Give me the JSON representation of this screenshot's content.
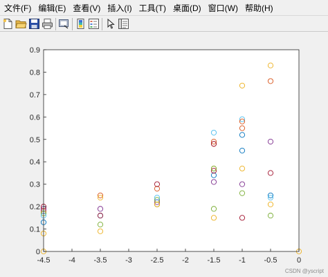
{
  "menu": {
    "items": [
      "文件(F)",
      "编辑(E)",
      "查看(V)",
      "插入(I)",
      "工具(T)",
      "桌面(D)",
      "窗口(W)",
      "帮助(H)"
    ]
  },
  "toolbar": {
    "buttons": [
      "new-file-icon",
      "open-folder-icon",
      "save-icon",
      "print-icon",
      "link-figure-icon",
      "colorbar-icon",
      "legend-icon",
      "pointer-icon",
      "property-inspector-icon"
    ]
  },
  "watermark": "CSDN @yscript",
  "chart_data": {
    "type": "scatter",
    "title": "",
    "xlabel": "",
    "ylabel": "",
    "xlim": [
      -4.5,
      0
    ],
    "ylim": [
      0,
      0.9
    ],
    "xticks": [
      "-4.5",
      "-4",
      "-3.5",
      "-3",
      "-2.5",
      "-2",
      "-1.5",
      "-1",
      "-0.5",
      "0"
    ],
    "yticks": [
      "0",
      "0.1",
      "0.2",
      "0.3",
      "0.4",
      "0.5",
      "0.6",
      "0.7",
      "0.8",
      "0.9"
    ],
    "xtick_values": [
      -4.5,
      -4,
      -3.5,
      -3,
      -2.5,
      -2,
      -1.5,
      -1,
      -0.5,
      0
    ],
    "ytick_values": [
      0,
      0.1,
      0.2,
      0.3,
      0.4,
      0.5,
      0.6,
      0.7,
      0.8,
      0.9
    ],
    "grid": false,
    "marker": "open circle",
    "series": [
      {
        "color": "#0072BD",
        "points": [
          [
            -4.5,
            0.13
          ],
          [
            -3.5,
            0.16
          ],
          [
            -2.5,
            0.21
          ],
          [
            -1.5,
            0.34
          ],
          [
            -1,
            0.45
          ],
          [
            -0.5,
            0.25
          ]
        ]
      },
      {
        "color": "#D95319",
        "points": [
          [
            -4.5,
            0.18
          ],
          [
            -3.5,
            0.25
          ],
          [
            -2.5,
            0.28
          ],
          [
            -1.5,
            0.48
          ],
          [
            -1,
            0.55
          ],
          [
            -0.5,
            0.76
          ]
        ]
      },
      {
        "color": "#EDB120",
        "points": [
          [
            -4.5,
            0.0
          ],
          [
            -3.5,
            0.24
          ],
          [
            -2.5,
            0.21
          ],
          [
            -1.5,
            0.37
          ],
          [
            -1,
            0.37
          ],
          [
            -0.5,
            0.83
          ],
          [
            0,
            0.0
          ]
        ]
      },
      {
        "color": "#7E2F8E",
        "points": [
          [
            -4.5,
            0.19
          ],
          [
            -3.5,
            0.19
          ],
          [
            -2.5,
            0.22
          ],
          [
            -1.5,
            0.31
          ],
          [
            -1,
            0.3
          ],
          [
            -0.5,
            0.49
          ]
        ]
      },
      {
        "color": "#77AC30",
        "points": [
          [
            -4.5,
            0.17
          ],
          [
            -3.5,
            0.12
          ],
          [
            -2.5,
            0.23
          ],
          [
            -1.5,
            0.19
          ],
          [
            -1,
            0.26
          ],
          [
            -0.5,
            0.16
          ]
        ]
      },
      {
        "color": "#4DBEEE",
        "points": [
          [
            -4.5,
            0.16
          ],
          [
            -3.5,
            0.16
          ],
          [
            -2.5,
            0.24
          ],
          [
            -1.5,
            0.53
          ],
          [
            -1,
            0.59
          ],
          [
            -0.5,
            0.24
          ]
        ]
      },
      {
        "color": "#A2142F",
        "points": [
          [
            -4.5,
            0.2
          ],
          [
            -3.5,
            0.16
          ],
          [
            -2.5,
            0.3
          ],
          [
            -1.5,
            0.36
          ],
          [
            -1,
            0.15
          ],
          [
            -0.5,
            0.35
          ]
        ]
      },
      {
        "color": "#EDB120",
        "points": [
          [
            -4.5,
            0.08
          ],
          [
            -3.5,
            0.09
          ],
          [
            -2.5,
            0.21
          ],
          [
            -1.5,
            0.15
          ],
          [
            -1,
            0.74
          ],
          [
            -0.5,
            0.21
          ]
        ]
      },
      {
        "color": "#D95319",
        "points": [
          [
            -1.5,
            0.49
          ],
          [
            -1,
            0.58
          ]
        ]
      },
      {
        "color": "#0072BD",
        "points": [
          [
            -1,
            0.52
          ]
        ]
      },
      {
        "color": "#77AC30",
        "points": [
          [
            -1.5,
            0.37
          ]
        ]
      },
      {
        "color": "#A2142F",
        "points": [
          [
            -1.5,
            0.48
          ]
        ]
      }
    ]
  }
}
